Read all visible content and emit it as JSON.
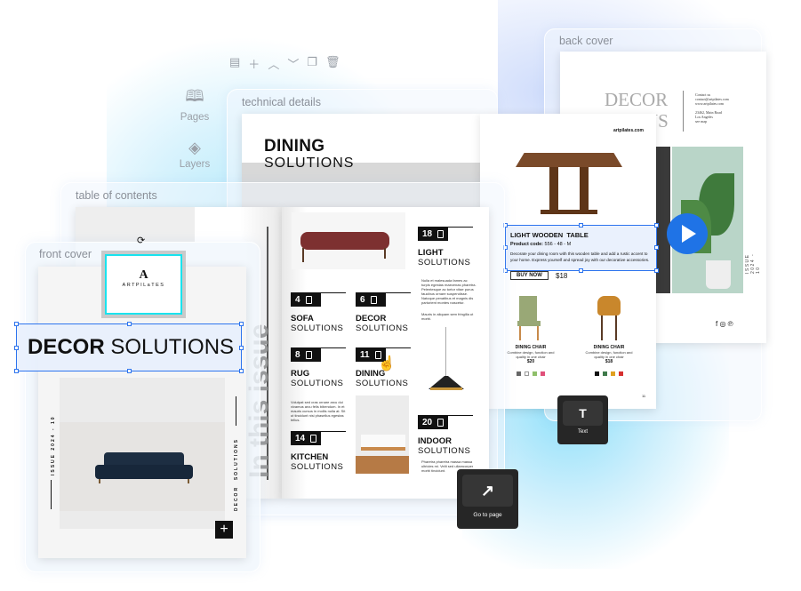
{
  "toolbar": {
    "icons": [
      "comment-icon",
      "plus-icon",
      "chevron-up-icon",
      "chevron-down-icon",
      "duplicate-icon",
      "trash-icon"
    ]
  },
  "sidebar": {
    "items": [
      {
        "label": "Pages",
        "icon": "book-icon"
      },
      {
        "label": "Layers",
        "icon": "layers-icon"
      }
    ]
  },
  "panels": {
    "back_cover": {
      "label": "back cover",
      "title1": "DECOR",
      "title2": "NS",
      "contact": [
        "Contact us",
        "contact@artpilates.com",
        "www.artpilates.com",
        "23462, Main Road",
        "Los Angeles",
        "see map"
      ],
      "vertical": "ISSUE 2024 - 10"
    },
    "technical": {
      "label": "technical details",
      "title_bold": "DINING",
      "title_light": "SOLUTIONS",
      "site": "artpilates.com",
      "product_title": "LIGHT WOODEN  TABLE",
      "code_label": "Product code:",
      "code": "556 - 48 - M",
      "description": "Decorate your dining room with this wooden table and add a rustic accent to your home. Express yourself and spread joy with our decorative accessories.",
      "buy": "BUY NOW",
      "price": "$18",
      "chairs": [
        {
          "name": "DINING CHAIR",
          "desc": "Combine design, function and quality in one chair",
          "price": "$20",
          "swatches": [
            "#666666",
            "#ffffff",
            "#8fbf6a",
            "#e0507a"
          ]
        },
        {
          "name": "DINING CHAIR",
          "desc": "Combine design, function and quality in one chair",
          "price": "$18",
          "swatches": [
            "#111111",
            "#3f7a4a",
            "#e0a020",
            "#d63030"
          ]
        }
      ],
      "page_num": "11"
    },
    "toc": {
      "label": "table of contents",
      "spine": "In this issue",
      "sections": [
        {
          "num": "4",
          "bold": "SOFA",
          "light": "SOLUTIONS"
        },
        {
          "num": "6",
          "bold": "DECOR",
          "light": "SOLUTIONS"
        },
        {
          "num": "8",
          "bold": "RUG",
          "light": "SOLUTIONS"
        },
        {
          "num": "11",
          "bold": "DINING",
          "light": "SOLUTIONS"
        },
        {
          "num": "14",
          "bold": "KITCHEN",
          "light": "SOLUTIONS"
        },
        {
          "num": "18",
          "bold": "LIGHT",
          "light": "SOLUTIONS"
        },
        {
          "num": "20",
          "bold": "INDOOR",
          "light": "SOLUTIONS"
        }
      ],
      "lorem1": "Nulla et malesuada fames ac turpis egestas maecenas pharetra. Pelentesque ac tortor vitae purus faucibus ornare suspendisse. Natoque penatibus et magnis dis parturient montes nascetur.",
      "lorem2": "Mauris in aliquam sem fringilla ut morbi.",
      "lorem3": "Volutpat sed cras ornare arcu dui vivamus arcu felis bibendum. In et mauris cursus in mollis nulla at. Sit ut tincidunt nisi phasellus egestas tellus.",
      "lorem4": "Pharetra pharetra massa massa ultricies mi. Velit sed ullamcorper morbi tincidunt."
    },
    "front": {
      "label": "front cover",
      "logo": "ARTPILaTES",
      "title_bold": "DECOR",
      "title_light": "SOLUTIONS",
      "vertical_left": "ISSUE 2024 - 10",
      "vertical_right": "DECOR  SOLUTIONS"
    }
  },
  "tooltips": {
    "text": {
      "glyph": "T",
      "label": "Text"
    },
    "goto": {
      "glyph": "↗",
      "label": "Go to page"
    }
  },
  "colors": {
    "selection": "#2d74ee",
    "logo_selection": "#19e3ee",
    "tooltip_bg": "#262626"
  }
}
